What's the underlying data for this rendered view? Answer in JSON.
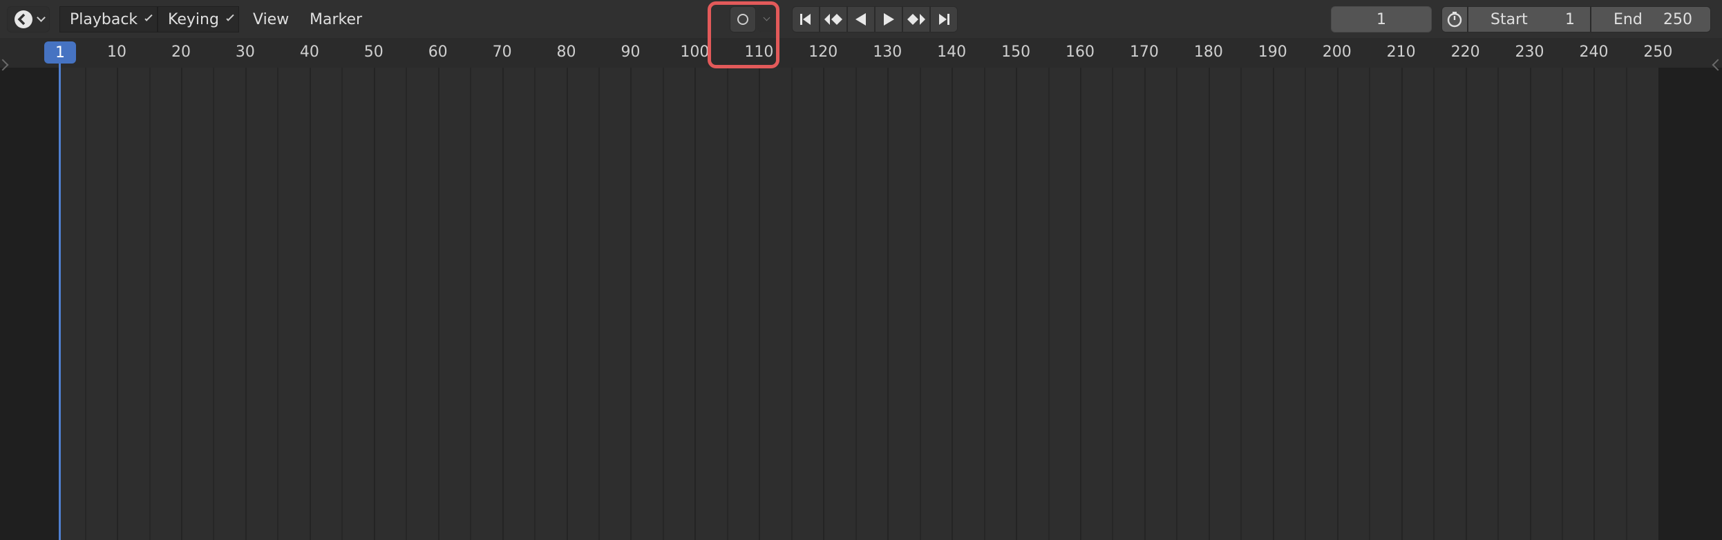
{
  "menus": {
    "playback": "Playback",
    "keying": "Keying",
    "view": "View",
    "marker": "Marker"
  },
  "transport": {
    "buttons": [
      "jump-start-icon",
      "prev-keyframe-icon",
      "play-reverse-icon",
      "play-icon",
      "next-keyframe-icon",
      "jump-end-icon"
    ]
  },
  "frame": {
    "current": "1",
    "start_label": "Start",
    "start_value": "1",
    "end_label": "End",
    "end_value": "250"
  },
  "ruler": {
    "current": "1",
    "ticks": [
      "10",
      "20",
      "30",
      "40",
      "50",
      "60",
      "70",
      "80",
      "90",
      "100",
      "110",
      "120",
      "130",
      "140",
      "150",
      "160",
      "170",
      "180",
      "190",
      "200",
      "210",
      "220",
      "230",
      "240",
      "250"
    ]
  },
  "colors": {
    "playhead": "#4673c2",
    "highlight": "#e35a5a"
  }
}
